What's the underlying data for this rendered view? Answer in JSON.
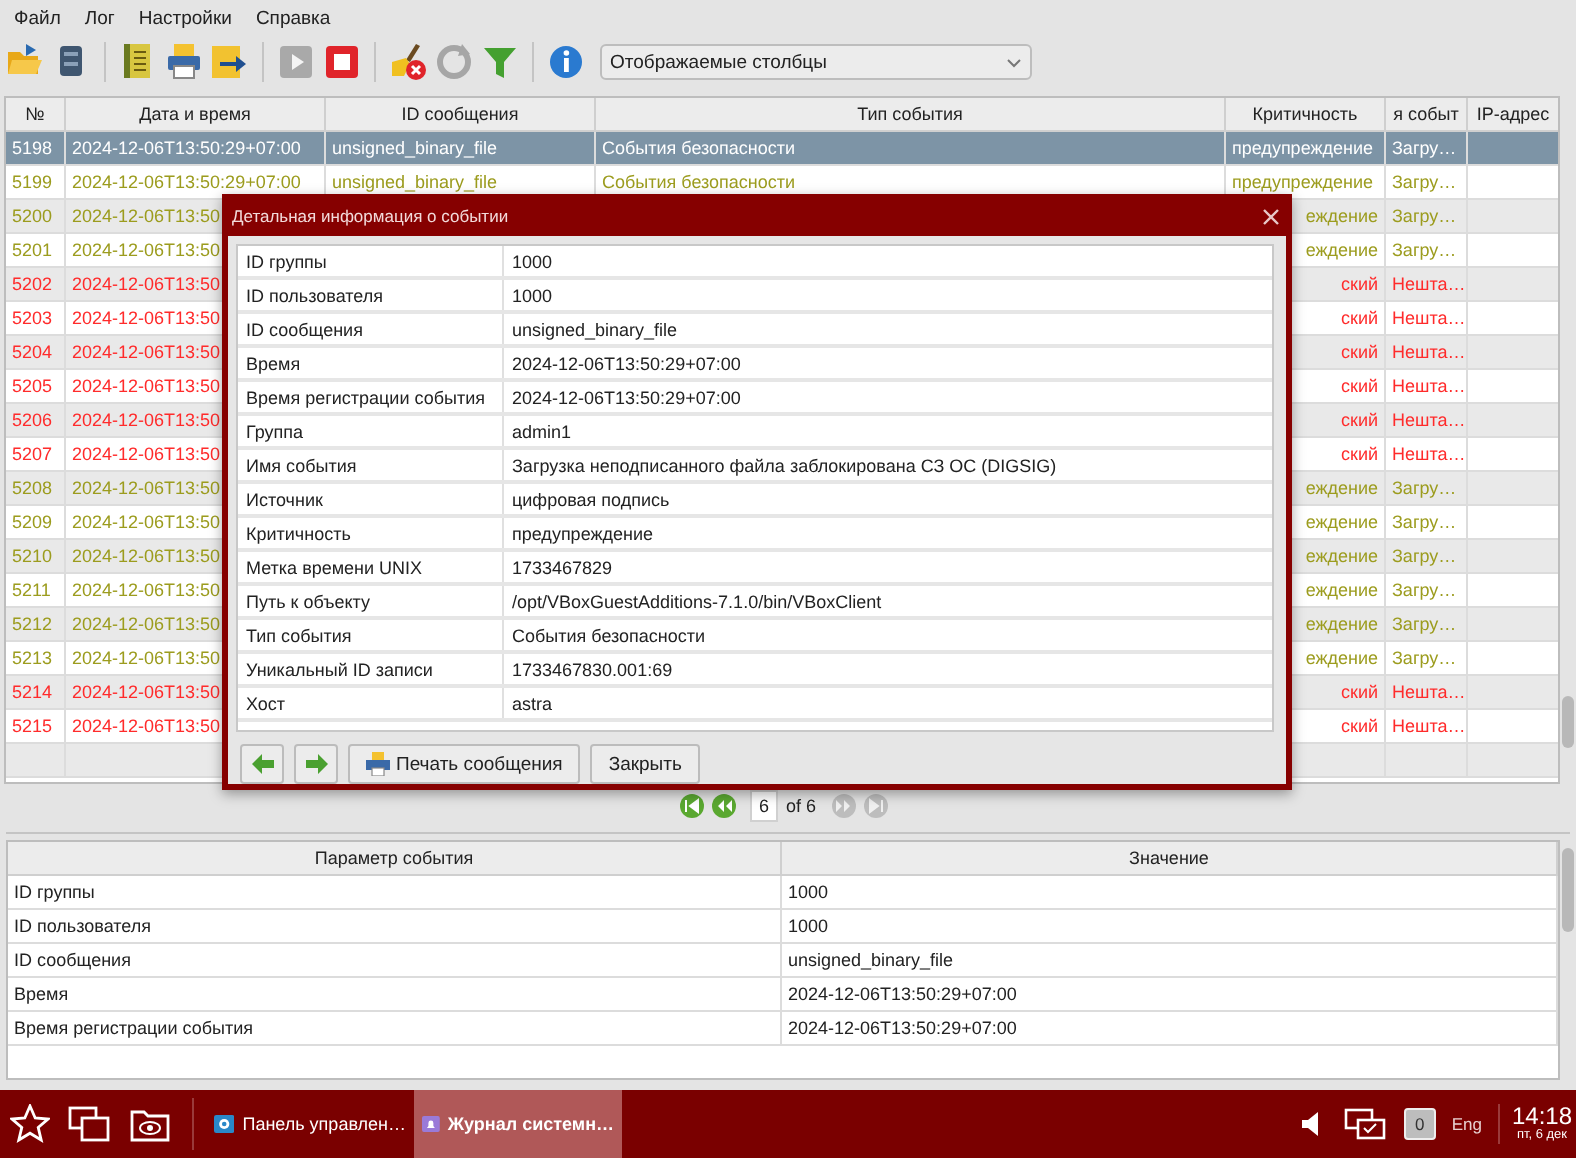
{
  "menu": [
    {
      "label": "Файл"
    },
    {
      "label": "Лог"
    },
    {
      "label": "Настройки"
    },
    {
      "label": "Справка"
    }
  ],
  "toolbar": [
    {
      "kind": "open",
      "disabled": false
    },
    {
      "kind": "disk",
      "disabled": false
    },
    {
      "kind": "separator"
    },
    {
      "kind": "ledger",
      "disabled": false
    },
    {
      "kind": "print",
      "disabled": false
    },
    {
      "kind": "export",
      "disabled": false
    },
    {
      "kind": "separator"
    },
    {
      "kind": "play",
      "disabled": true
    },
    {
      "kind": "stop",
      "disabled": false
    },
    {
      "kind": "separator"
    },
    {
      "kind": "clear",
      "disabled": false
    },
    {
      "kind": "refresh",
      "disabled": true
    },
    {
      "kind": "filter",
      "disabled": false
    },
    {
      "kind": "separator"
    },
    {
      "kind": "info",
      "disabled": false
    }
  ],
  "columns_dropdown": {
    "value": "Отображаемые столбцы"
  },
  "events_table": {
    "columns": [
      "№",
      "Дата и время",
      "ID сообщения",
      "Тип события",
      "Критичность",
      "я событ",
      "IP-адрес"
    ],
    "rows": [
      {
        "number": "5198",
        "datetime": "2024-12-06T13:50:29+07:00",
        "message_id": "unsigned_binary_file",
        "event_type": "События безопасности",
        "criticality": "предупреждение",
        "event_name": "Загру…",
        "selected": true
      },
      {
        "number": "5199",
        "datetime": "2024-12-06T13:50:29+07:00",
        "message_id": "unsigned_binary_file",
        "event_type": "События безопасности",
        "criticality": "предупреждение",
        "event_name": "Загру…",
        "selected": false,
        "color": "#9c9c1e"
      },
      {
        "number": "5200",
        "datetime": "2024-12-06T13:50",
        "criticality": "еждение",
        "event_name": "Загру…",
        "selected": false,
        "color": "#9c9c1e"
      },
      {
        "number": "5201",
        "datetime": "2024-12-06T13:50",
        "criticality": "еждение",
        "event_name": "Загру…",
        "selected": false,
        "color": "#9c9c1e"
      },
      {
        "number": "5202",
        "datetime": "2024-12-06T13:50",
        "criticality": "ский",
        "event_name": "Нешта…",
        "selected": false,
        "color": "#ff2b2b"
      },
      {
        "number": "5203",
        "datetime": "2024-12-06T13:50",
        "criticality": "ский",
        "event_name": "Нешта…",
        "selected": false,
        "color": "#ff2b2b"
      },
      {
        "number": "5204",
        "datetime": "2024-12-06T13:50",
        "criticality": "ский",
        "event_name": "Нешта…",
        "selected": false,
        "color": "#ff2b2b"
      },
      {
        "number": "5205",
        "datetime": "2024-12-06T13:50",
        "criticality": "ский",
        "event_name": "Нешта…",
        "selected": false,
        "color": "#ff2b2b"
      },
      {
        "number": "5206",
        "datetime": "2024-12-06T13:50",
        "criticality": "ский",
        "event_name": "Нешта…",
        "selected": false,
        "color": "#ff2b2b"
      },
      {
        "number": "5207",
        "datetime": "2024-12-06T13:50",
        "criticality": "ский",
        "event_name": "Нешта…",
        "selected": false,
        "color": "#ff2b2b"
      },
      {
        "number": "5208",
        "datetime": "2024-12-06T13:50",
        "criticality": "еждение",
        "event_name": "Загру…",
        "selected": false,
        "color": "#9c9c1e"
      },
      {
        "number": "5209",
        "datetime": "2024-12-06T13:50",
        "criticality": "еждение",
        "event_name": "Загру…",
        "selected": false,
        "color": "#9c9c1e"
      },
      {
        "number": "5210",
        "datetime": "2024-12-06T13:50",
        "criticality": "еждение",
        "event_name": "Загру…",
        "selected": false,
        "color": "#9c9c1e"
      },
      {
        "number": "5211",
        "datetime": "2024-12-06T13:50",
        "criticality": "еждение",
        "event_name": "Загру…",
        "selected": false,
        "color": "#9c9c1e"
      },
      {
        "number": "5212",
        "datetime": "2024-12-06T13:50",
        "criticality": "еждение",
        "event_name": "Загру…",
        "selected": false,
        "color": "#9c9c1e"
      },
      {
        "number": "5213",
        "datetime": "2024-12-06T13:50",
        "criticality": "еждение",
        "event_name": "Загру…",
        "selected": false,
        "color": "#9c9c1e"
      },
      {
        "number": "5214",
        "datetime": "2024-12-06T13:50",
        "criticality": "ский",
        "event_name": "Нешта…",
        "selected": false,
        "color": "#ff2b2b"
      },
      {
        "number": "5215",
        "datetime": "2024-12-06T13:50",
        "criticality": "ский",
        "event_name": "Нешта…",
        "selected": false,
        "color": "#ff2b2b"
      }
    ]
  },
  "dialog": {
    "title": "Детальная информация о событии",
    "fields": [
      {
        "label": "ID группы",
        "value": "1000"
      },
      {
        "label": "ID пользователя",
        "value": "1000"
      },
      {
        "label": "ID сообщения",
        "value": "unsigned_binary_file"
      },
      {
        "label": "Время",
        "value": "2024-12-06T13:50:29+07:00"
      },
      {
        "label": "Время регистрации события",
        "value": "2024-12-06T13:50:29+07:00"
      },
      {
        "label": "Группа",
        "value": "admin1"
      },
      {
        "label": "Имя события",
        "value": "Загрузка неподписанного файла заблокирована СЗ ОС (DIGSIG)"
      },
      {
        "label": "Источник",
        "value": "цифровая подпись"
      },
      {
        "label": "Критичность",
        "value": "предупреждение"
      },
      {
        "label": "Метка времени UNIX",
        "value": "1733467829"
      },
      {
        "label": "Путь к объекту",
        "value": "/opt/VBoxGuestAdditions-7.1.0/bin/VBoxClient"
      },
      {
        "label": "Тип события",
        "value": "События безопасности"
      },
      {
        "label": "Уникальный ID записи",
        "value": "1733467830.001:69"
      },
      {
        "label": "Хост",
        "value": "astra"
      }
    ],
    "buttons": [
      {
        "kind": "back"
      },
      {
        "kind": "forward"
      },
      {
        "kind": "print",
        "label": "Печать сообщения"
      },
      {
        "kind": "close",
        "label": "Закрыть"
      }
    ]
  },
  "pager": {
    "buttons": [
      {
        "kind": "first",
        "disabled": false
      },
      {
        "kind": "previous",
        "disabled": false
      },
      {
        "kind": "next",
        "disabled": true
      },
      {
        "kind": "last",
        "disabled": true
      }
    ],
    "page": "6",
    "total": "of 6"
  },
  "details_table": {
    "columns": [
      "Параметр события",
      "Значение"
    ],
    "rows": [
      {
        "parameter": "ID группы",
        "value": "1000"
      },
      {
        "parameter": "ID пользователя",
        "value": "1000"
      },
      {
        "parameter": "ID сообщения",
        "value": "unsigned_binary_file"
      },
      {
        "parameter": "Время",
        "value": "2024-12-06T13:50:29+07:00"
      },
      {
        "parameter": "Время регистрации события",
        "value": "2024-12-06T13:50:29+07:00"
      }
    ]
  },
  "taskbar": {
    "tasks": [
      {
        "label": "Панель управлен…",
        "kind": "settings",
        "selected": false
      },
      {
        "label": "Журнал системн…",
        "kind": "journal",
        "selected": true
      }
    ],
    "badge": "0",
    "language": "Eng",
    "time": "14:18",
    "date": "пт, 6 дек"
  }
}
